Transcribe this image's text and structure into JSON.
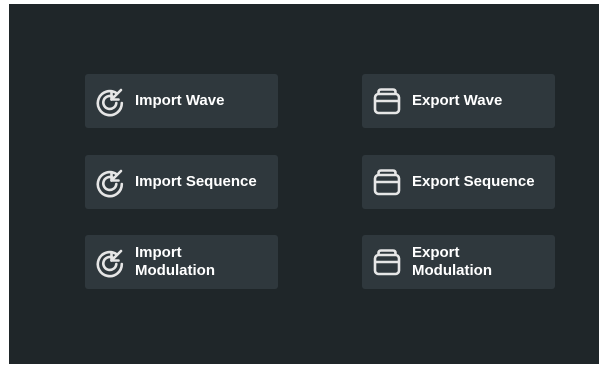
{
  "tiles": {
    "import_wave": {
      "label": "Import Wave",
      "icon": "import-icon"
    },
    "export_wave": {
      "label": "Export Wave",
      "icon": "export-icon"
    },
    "import_sequence": {
      "label": "Import Sequence",
      "icon": "import-icon"
    },
    "export_sequence": {
      "label": "Export Sequence",
      "icon": "export-icon"
    },
    "import_modulation": {
      "label": "Import Modulation",
      "icon": "import-icon"
    },
    "export_modulation": {
      "label": "Export Modulation",
      "icon": "export-icon"
    }
  },
  "colors": {
    "background": "#1f2629",
    "tile": "#2f383d",
    "text": "#ffffff",
    "icon": "#e6e6e6"
  }
}
